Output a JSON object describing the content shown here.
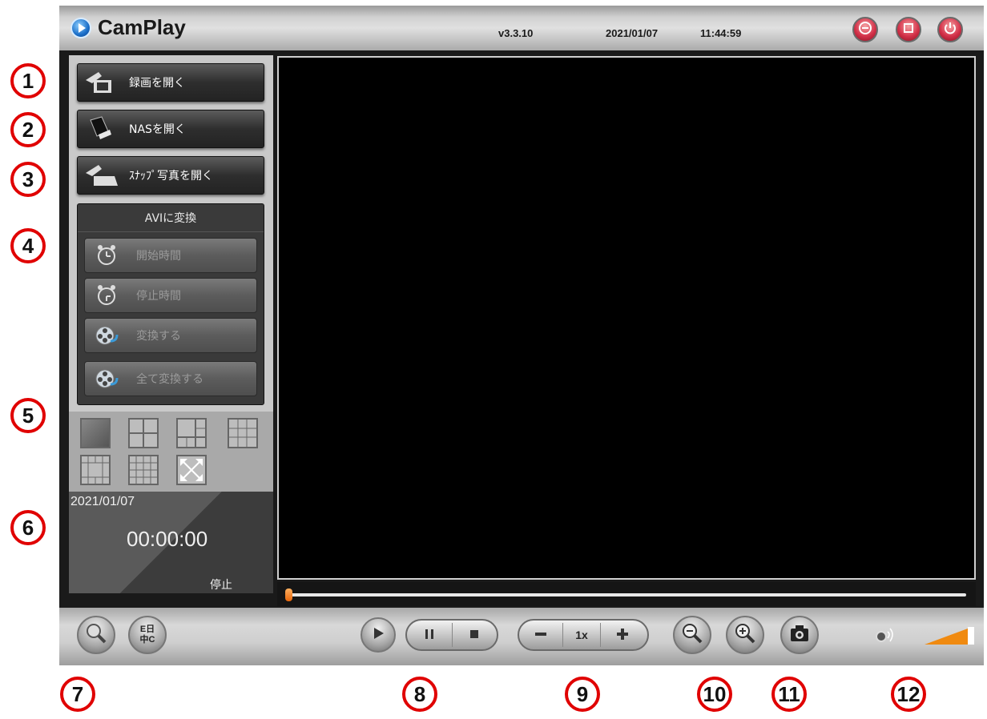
{
  "callouts": [
    "1",
    "2",
    "3",
    "4",
    "5",
    "6",
    "7",
    "8",
    "9",
    "10",
    "11",
    "12"
  ],
  "header": {
    "app_name": "CamPlay",
    "version": "v3.3.10",
    "date": "2021/01/07",
    "time": "11:44:59"
  },
  "window_buttons": [
    "minimize-icon",
    "restore-icon",
    "power-icon"
  ],
  "sidebar": {
    "open_recording": "録画を開く",
    "open_nas": "NASを開く",
    "open_snapshot": "ｽﾅｯﾌﾟ写真を開く",
    "avi": {
      "title": "AVIに変換",
      "start_time": "開始時間",
      "stop_time": "停止時間",
      "convert": "変換する",
      "convert_all": "全て変換する"
    },
    "status": {
      "date": "2021/01/07",
      "time": "00:00:00",
      "state": "停止"
    }
  },
  "playback": {
    "speed": "1x",
    "progress_fraction": 0.0
  },
  "bottom": {
    "lang_top": "E日",
    "lang_bottom": "中C"
  },
  "colors": {
    "callout": "#e00000",
    "accent_orange": "#f08a10",
    "window_button": "#d4324a"
  }
}
